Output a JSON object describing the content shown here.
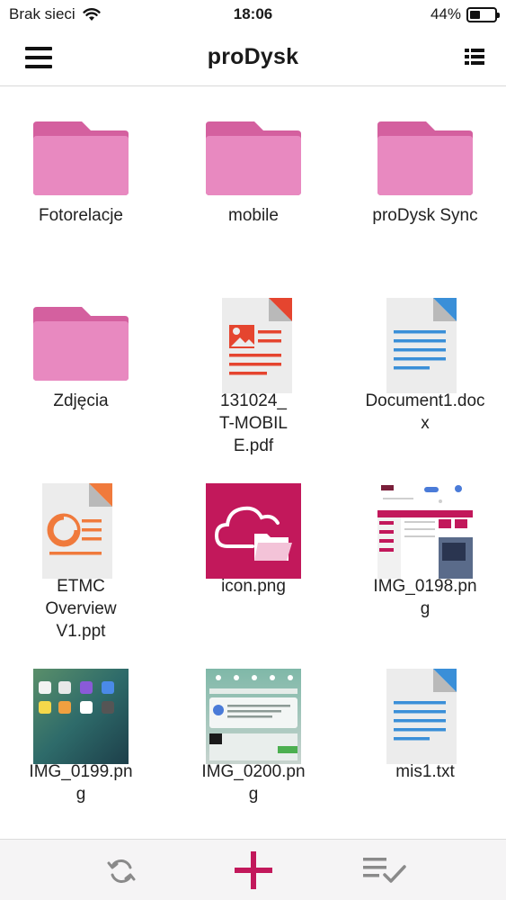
{
  "status_bar": {
    "carrier": "Brak sieci",
    "time": "18:06",
    "battery_percent": "44%",
    "battery_level": 0.44,
    "wifi_icon": "wifi-icon"
  },
  "header": {
    "title": "proDysk",
    "menu_icon": "hamburger-menu-icon",
    "view_icon": "list-view-icon"
  },
  "colors": {
    "folder": "#e889c0",
    "folder_dark": "#d4609f",
    "brand": "#c2185b",
    "pdf_accent": "#e5452f",
    "doc_accent": "#3a8fd8",
    "ppt_accent": "#f07a3c"
  },
  "files": [
    {
      "name": "Fotorelacje",
      "type": "folder"
    },
    {
      "name": "mobile",
      "type": "folder"
    },
    {
      "name": "proDysk Sync",
      "type": "folder"
    },
    {
      "name": "Zdjęcia",
      "type": "folder"
    },
    {
      "name": "131024_T-MOBILE.pdf",
      "type": "pdf"
    },
    {
      "name": "Document1.docx",
      "type": "doc"
    },
    {
      "name": "ETMC Overview V1.ppt",
      "type": "ppt"
    },
    {
      "name": "icon.png",
      "type": "image"
    },
    {
      "name": "IMG_0198.png",
      "type": "image"
    },
    {
      "name": "IMG_0199.png",
      "type": "image"
    },
    {
      "name": "IMG_0200.png",
      "type": "image"
    },
    {
      "name": "mis1.txt",
      "type": "text"
    }
  ],
  "toolbar": {
    "refresh_icon": "refresh-icon",
    "add_icon": "plus-icon",
    "select_icon": "select-list-icon"
  }
}
